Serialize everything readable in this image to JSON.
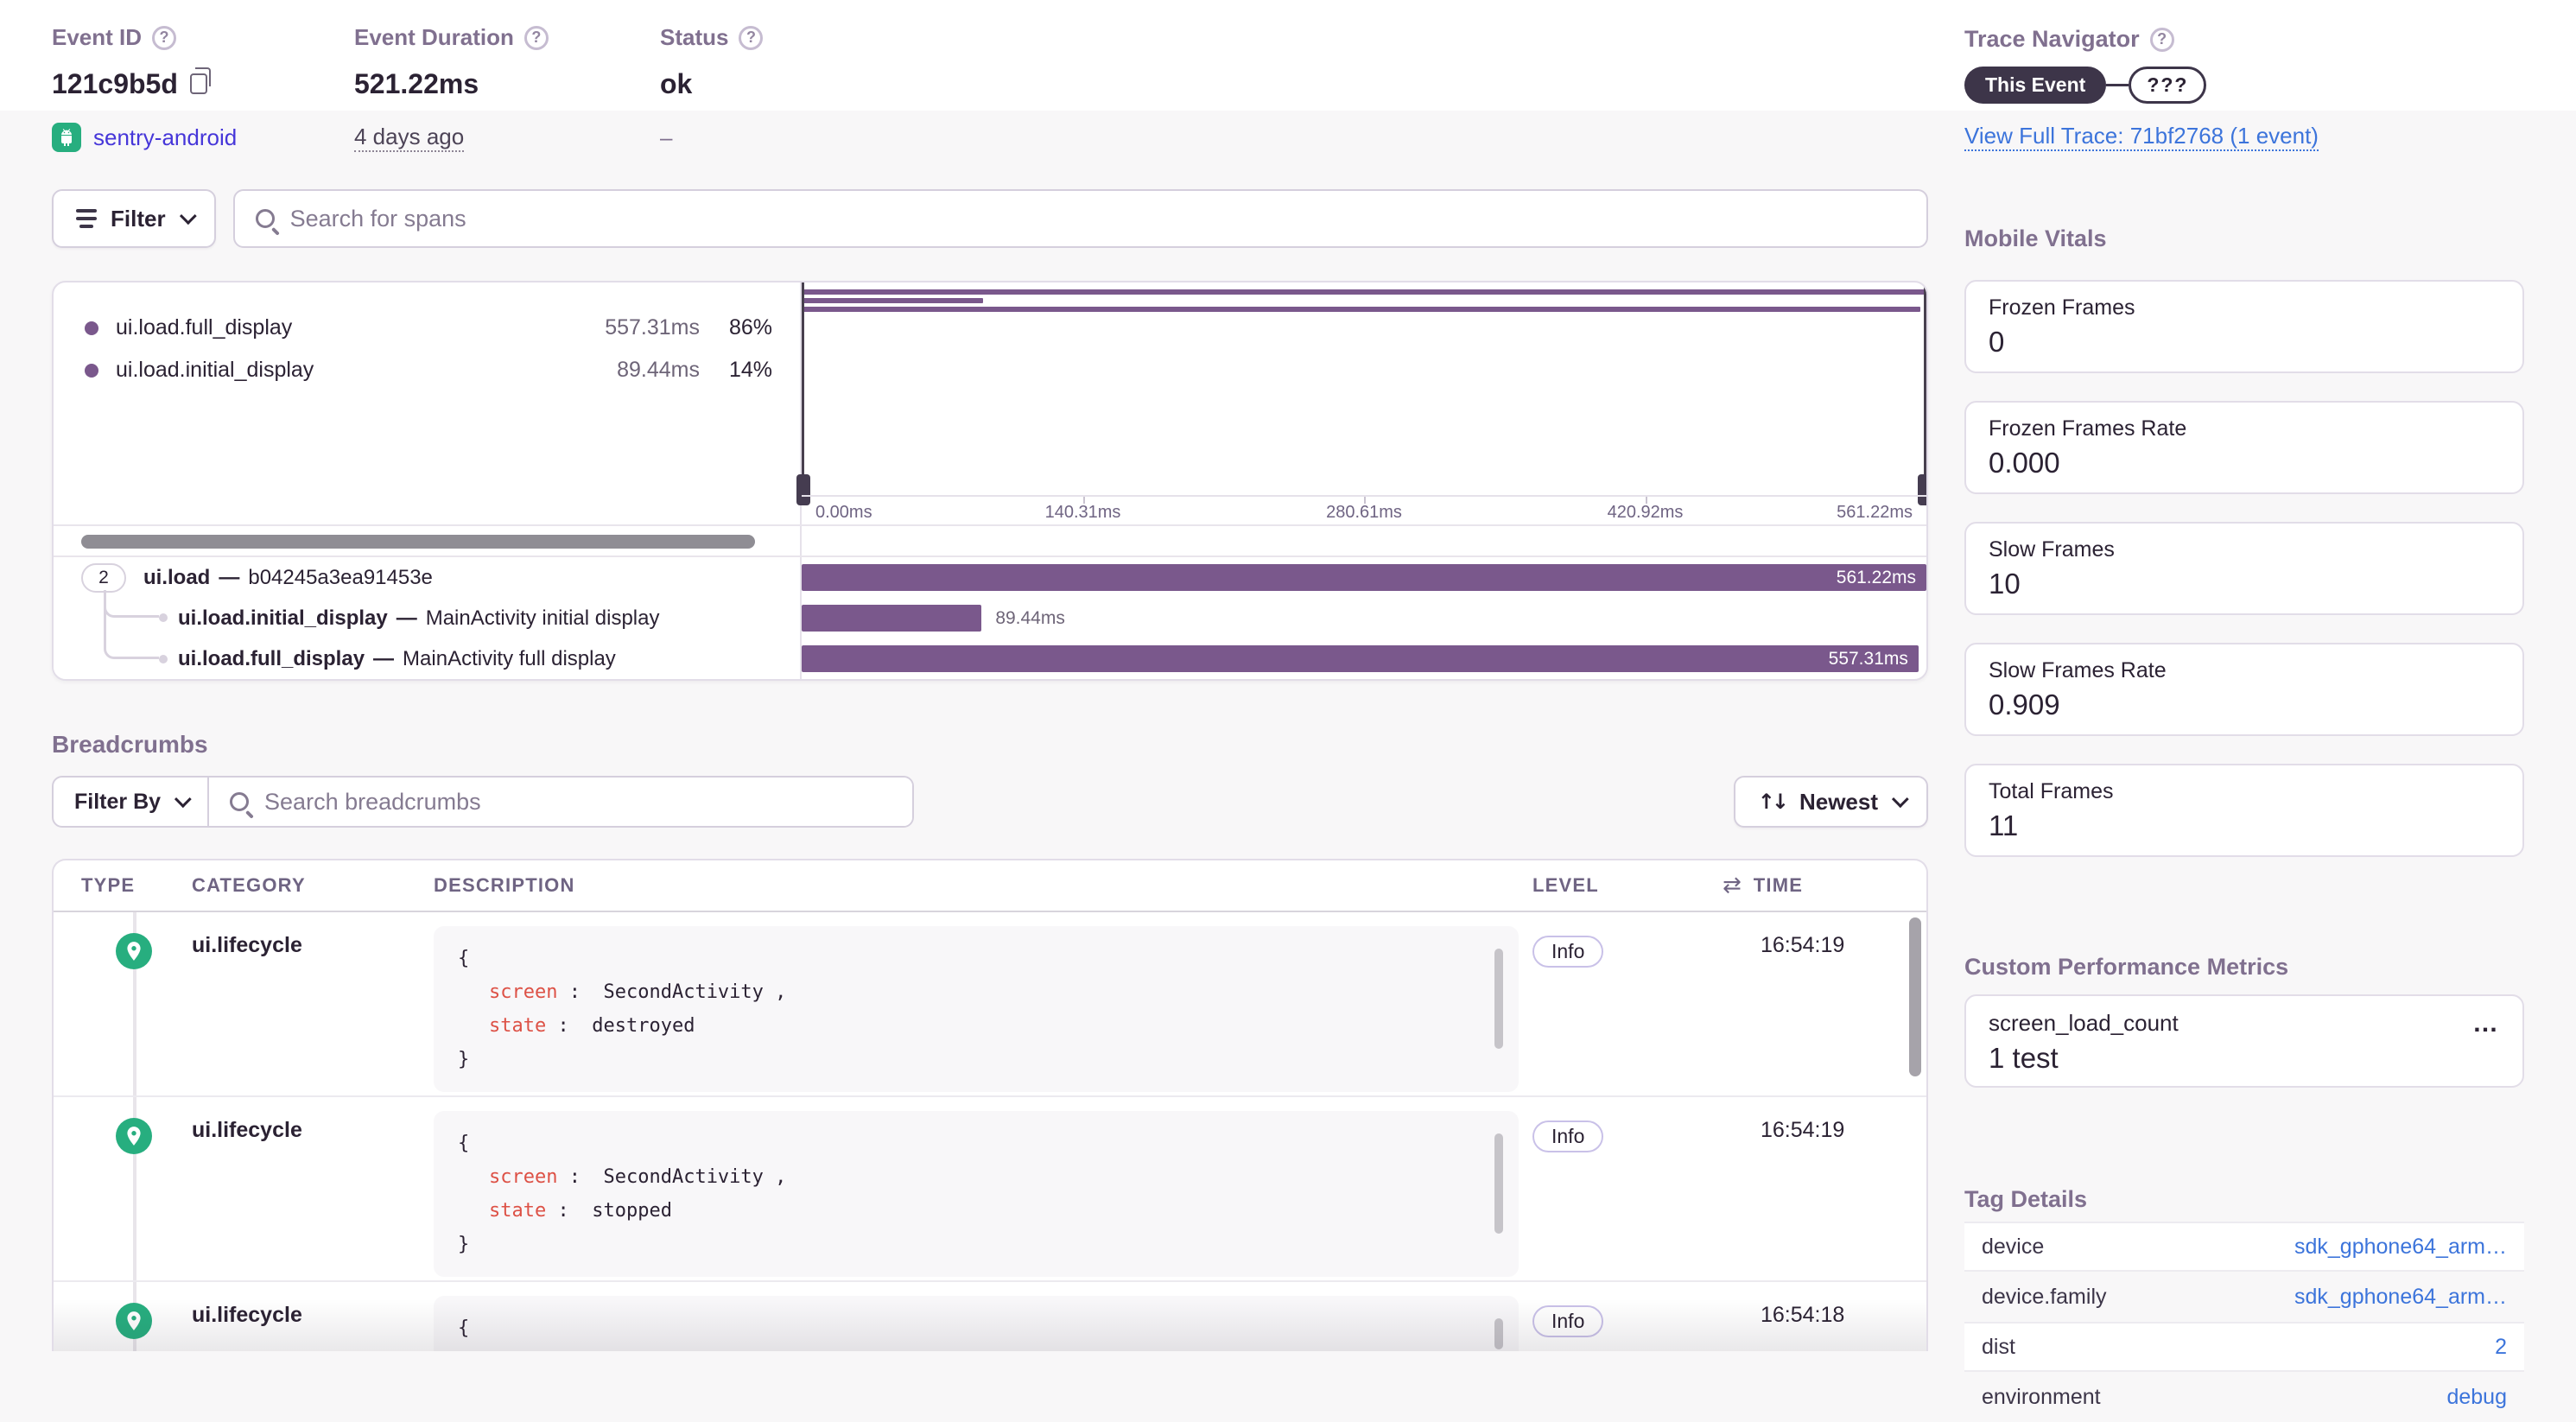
{
  "event_header": {
    "event_id": {
      "label": "Event ID",
      "value": "121c9b5d",
      "project": "sentry-android"
    },
    "duration": {
      "label": "Event Duration",
      "value": "521.22ms",
      "age": "4 days ago"
    },
    "status": {
      "label": "Status",
      "value": "ok",
      "sub": "–"
    }
  },
  "trace_navigator": {
    "title": "Trace Navigator",
    "this_event_label": "This Event",
    "unknown_label": "???",
    "link": "View Full Trace: 71bf2768 (1 event)"
  },
  "span_toolbar": {
    "filter_label": "Filter",
    "search_placeholder": "Search for spans"
  },
  "spans": {
    "legend": [
      {
        "name": "ui.load.full_display",
        "duration": "557.31ms",
        "pct": "86%"
      },
      {
        "name": "ui.load.initial_display",
        "duration": "89.44ms",
        "pct": "14%"
      }
    ],
    "axis": [
      "0.00ms",
      "140.31ms",
      "280.61ms",
      "420.92ms",
      "561.22ms"
    ],
    "tree": [
      {
        "badge": "2",
        "op": "ui.load",
        "sep": "—",
        "desc": "b04245a3ea91453e",
        "duration": "561.22ms"
      },
      {
        "op": "ui.load.initial_display",
        "sep": "—",
        "desc": "MainActivity initial display",
        "duration": "89.44ms"
      },
      {
        "op": "ui.load.full_display",
        "sep": "—",
        "desc": "MainActivity full display",
        "duration": "557.31ms"
      }
    ]
  },
  "breadcrumbs": {
    "title": "Breadcrumbs",
    "filter_label": "Filter By",
    "search_placeholder": "Search breadcrumbs",
    "sort_label": "Newest",
    "columns": {
      "type": "TYPE",
      "category": "CATEGORY",
      "description": "DESCRIPTION",
      "level": "LEVEL",
      "time": "TIME"
    },
    "punct": {
      "open": "{",
      "close": "}",
      "colon": ":",
      "comma": ","
    },
    "rows": [
      {
        "category": "ui.lifecycle",
        "level": "Info",
        "time": "16:54:19",
        "entries": [
          {
            "key": "screen",
            "value": "SecondActivity"
          },
          {
            "key": "state",
            "value": "destroyed"
          }
        ]
      },
      {
        "category": "ui.lifecycle",
        "level": "Info",
        "time": "16:54:19",
        "entries": [
          {
            "key": "screen",
            "value": "SecondActivity"
          },
          {
            "key": "state",
            "value": "stopped"
          }
        ]
      },
      {
        "category": "ui.lifecycle",
        "level": "Info",
        "time": "16:54:18",
        "entries": []
      }
    ]
  },
  "mobile_vitals": {
    "title": "Mobile Vitals",
    "cards": [
      {
        "label": "Frozen Frames",
        "value": "0"
      },
      {
        "label": "Frozen Frames Rate",
        "value": "0.000"
      },
      {
        "label": "Slow Frames",
        "value": "10"
      },
      {
        "label": "Slow Frames Rate",
        "value": "0.909"
      },
      {
        "label": "Total Frames",
        "value": "11"
      }
    ]
  },
  "custom_metrics": {
    "title": "Custom Performance Metrics",
    "cards": [
      {
        "label": "screen_load_count",
        "value": "1 test",
        "menu": "•••"
      }
    ]
  },
  "tag_details": {
    "title": "Tag Details",
    "rows": [
      {
        "key": "device",
        "value": "sdk_gphone64_arm…"
      },
      {
        "key": "device.family",
        "value": "sdk_gphone64_arm…"
      },
      {
        "key": "dist",
        "value": "2"
      },
      {
        "key": "environment",
        "value": "debug"
      }
    ]
  },
  "colors": {
    "accent_purple": "#7a588c",
    "project_green": "#27ae7f",
    "link_blue": "#3c74db",
    "project_link_purple": "#4636d9",
    "dark_pill": "#3d3549",
    "json_key_red": "#dd5146"
  }
}
